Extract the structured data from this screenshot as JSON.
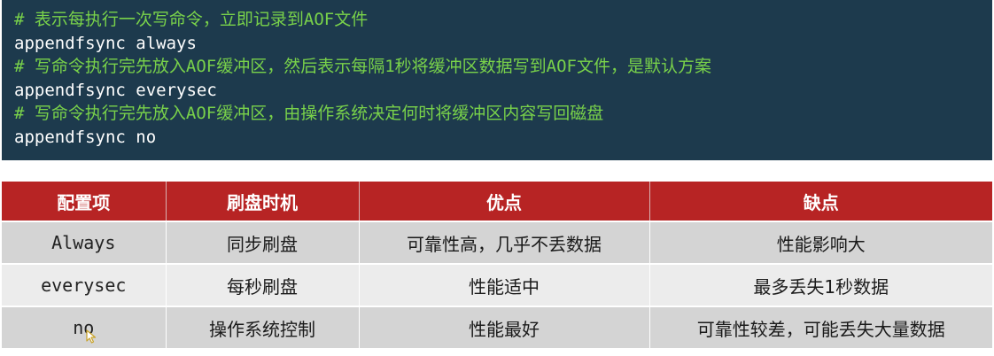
{
  "code": {
    "lines": [
      {
        "kind": "comment",
        "text": "# 表示每执行一次写命令，立即记录到AOF文件"
      },
      {
        "kind": "code",
        "text": "appendfsync always"
      },
      {
        "kind": "comment",
        "text": "# 写命令执行完先放入AOF缓冲区，然后表示每隔1秒将缓冲区数据写到AOF文件，是默认方案"
      },
      {
        "kind": "code",
        "text": "appendfsync everysec"
      },
      {
        "kind": "comment",
        "text": "# 写命令执行完先放入AOF缓冲区，由操作系统决定何时将缓冲区内容写回磁盘"
      },
      {
        "kind": "code",
        "text": "appendfsync no"
      }
    ]
  },
  "table": {
    "headers": [
      "配置项",
      "刷盘时机",
      "优点",
      "缺点"
    ],
    "rows": [
      [
        "Always",
        "同步刷盘",
        "可靠性高，几乎不丢数据",
        "性能影响大"
      ],
      [
        "everysec",
        "每秒刷盘",
        "性能适中",
        "最多丢失1秒数据"
      ],
      [
        "no",
        "操作系统控制",
        "性能最好",
        "可靠性较差，可能丢失大量数据"
      ]
    ]
  },
  "colors": {
    "code_background": "#1d3a4d",
    "comment": "#79d24a",
    "code_text": "#ffffff",
    "header_background": "#b72424",
    "row_dark": "#d4d4d4",
    "row_light": "#ececec"
  },
  "icons": {
    "cursor": "mouse-pointer-icon"
  }
}
